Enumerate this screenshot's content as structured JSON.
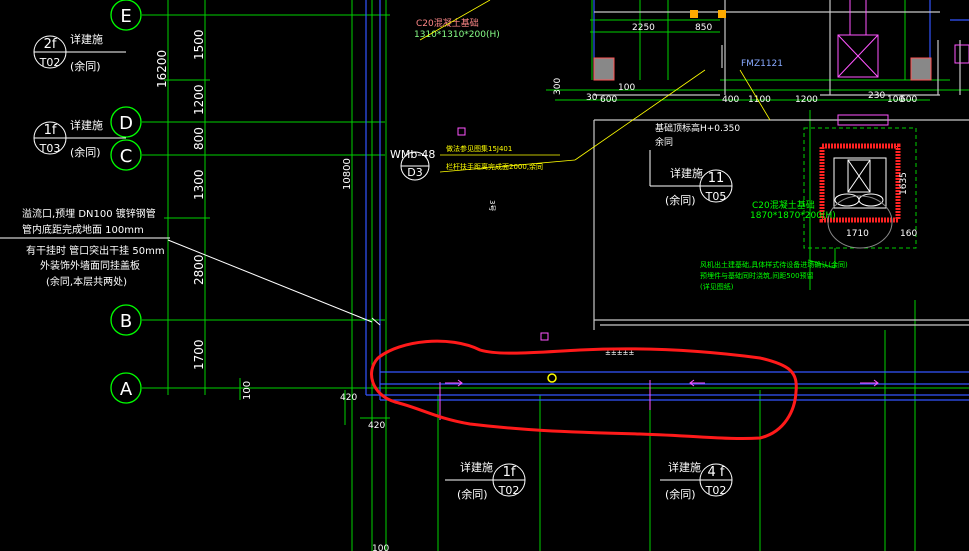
{
  "colors": {
    "background": "#000000",
    "grid_green": "#00ff00",
    "text_white": "#ffffff",
    "wall_blue": "#3355ff",
    "detail_magenta": "#ff55ff",
    "annotation_yellow": "#ffff00",
    "cloud_red": "#ff1a1a",
    "leader_white": "#ffffff"
  },
  "axes": {
    "E": "E",
    "D": "D",
    "C": "C",
    "B": "B",
    "A": "A"
  },
  "dims_vertical": [
    "16200",
    "1500",
    "1200",
    "800",
    "1300",
    "2800",
    "1700",
    "10800"
  ],
  "dims_small": [
    "100",
    "420",
    "420",
    "100",
    "300",
    "30",
    "30",
    "100",
    "100"
  ],
  "detail_refs": {
    "ref_2f_top": "2f",
    "ref_2f_bottom": "T02",
    "ref_1f_top": "1f",
    "ref_1f_bottom": "T03",
    "ref_11_top": "11",
    "ref_11_bottom": "T05",
    "ref_d3": "D3",
    "ref_1f_b_top": "1f",
    "ref_1f_b_bottom": "T02",
    "ref_4f_top": "4 f",
    "ref_4f_bottom": "T02"
  },
  "labels": {
    "see_detail": "详建施",
    "same_rest": "(余同)",
    "wmb": "WMb-48",
    "overflow_1": "溢流口,预埋   DN100    镀锌钢管",
    "overflow_2": "管内底距完成地面      100mm",
    "overflow_3": "有干挂时  管口突出干挂         50mm",
    "overflow_4": "外装饰外墙面同挂盖板",
    "overflow_5": "(余同,本层共两处)"
  },
  "annotations": {
    "c20_top_1": "C20混凝土基础",
    "c20_top_2": "1310*1310*200(H)",
    "c20_right_1": "C20混凝土基础",
    "c20_right_2": "1870*1870*200(H)",
    "base_top": "基础顶标高H+0.350",
    "base_top_rest": "余同",
    "fm": "FMZ1121",
    "yellow_note_1": "做法参见图集15J401",
    "yellow_note_2": "栏杆扶手距离完成面2000,余同",
    "green_note_1": "风机出土建基础,具体样式待设备进场确认(余同)",
    "green_note_2": "预埋件与基础同时浇筑,间距500预留",
    "green_note_3": "(详见图纸)",
    "vert_note": "3号",
    "mid_note": "±±±±±"
  },
  "dims_top": [
    "2250",
    "850",
    "30",
    "600",
    "100",
    "400",
    "1100",
    "1200",
    "230",
    "100",
    "600",
    "1635",
    "1710",
    "160"
  ]
}
